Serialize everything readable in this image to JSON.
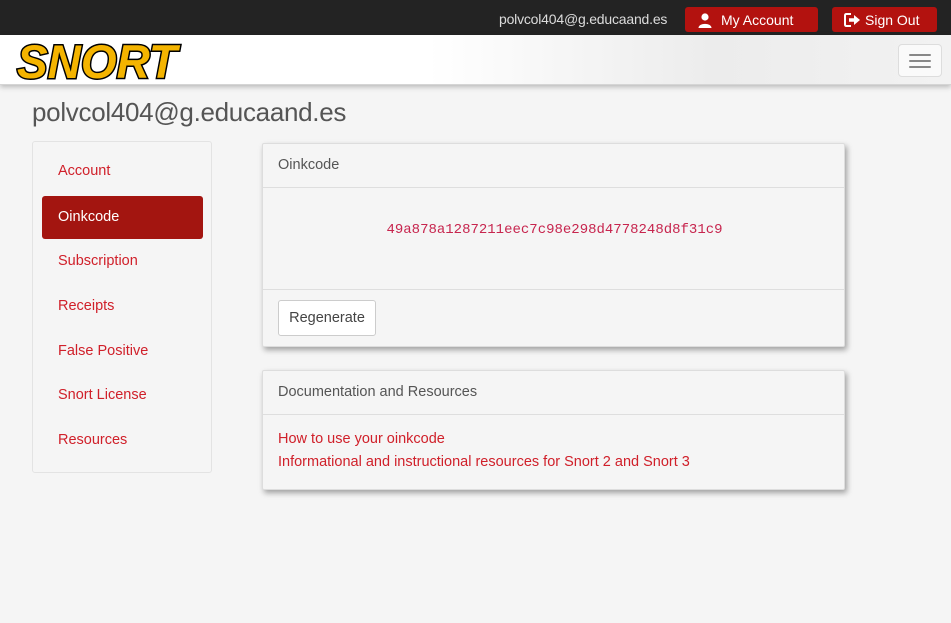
{
  "topbar": {
    "email": "polvcol404@g.educaand.es",
    "my_account_label": "My Account",
    "sign_out_label": "Sign Out"
  },
  "brand": {
    "logo_text": "SNORT"
  },
  "page": {
    "title": "polvcol404@g.educaand.es"
  },
  "sidebar": {
    "items": [
      {
        "label": "Account",
        "active": false
      },
      {
        "label": "Oinkcode",
        "active": true
      },
      {
        "label": "Subscription",
        "active": false
      },
      {
        "label": "Receipts",
        "active": false
      },
      {
        "label": "False Positive",
        "active": false
      },
      {
        "label": "Snort License",
        "active": false
      },
      {
        "label": "Resources",
        "active": false
      }
    ]
  },
  "oinkcode_panel": {
    "heading": "Oinkcode",
    "code": "49a878a1287211eec7c98e298d4778248d8f31c9",
    "regenerate_label": "Regenerate"
  },
  "docs_panel": {
    "heading": "Documentation and Resources",
    "links": [
      "How to use your oinkcode",
      "Informational and instructional resources for Snort 2 and Snort 3"
    ]
  },
  "colors": {
    "accent": "#b3120f",
    "active_nav": "#a31510",
    "link": "#d0202a",
    "topbar_bg": "#232323",
    "code_text": "#c7254e"
  }
}
